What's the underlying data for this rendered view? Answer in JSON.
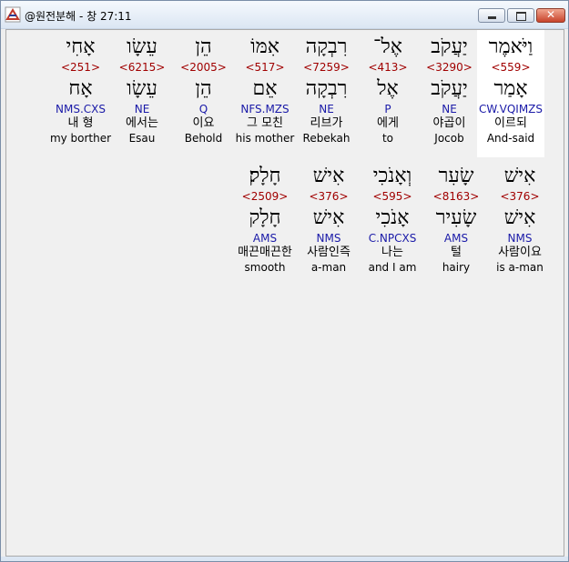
{
  "window": {
    "title": "@원전분해 - 창 27:11",
    "close_glyph": "✕"
  },
  "row1": [
    {
      "heb": "וַיֹּאמֶר",
      "strong": "<559>",
      "lemma": "אָמַר",
      "parse": "CW.VQIMZS",
      "kor": "이르되",
      "eng": "And-said",
      "selected": true
    },
    {
      "heb": "יַעֲקֹב",
      "strong": "<3290>",
      "lemma": "יַעֲקֹב",
      "parse": "NE",
      "kor": "야곱이",
      "eng": "Jocob",
      "selected": false
    },
    {
      "heb": "אֶל־",
      "strong": "<413>",
      "lemma": "אֶל",
      "parse": "P",
      "kor": "에게",
      "eng": "to",
      "selected": false
    },
    {
      "heb": "רִבְקָה",
      "strong": "<7259>",
      "lemma": "רִבְקָה",
      "parse": "NE",
      "kor": "리브가",
      "eng": "Rebekah",
      "selected": false
    },
    {
      "heb": "אִמּוֹ",
      "strong": "<517>",
      "lemma": "אֵם",
      "parse": "NFS.MZS",
      "kor": "그 모친",
      "eng": "his mother",
      "selected": false
    },
    {
      "heb": "הֵן",
      "strong": "<2005>",
      "lemma": "הֵן",
      "parse": "Q",
      "kor": "이요",
      "eng": "Behold",
      "selected": false
    },
    {
      "heb": "עֵשָׂו",
      "strong": "<6215>",
      "lemma": "עֵשָׂו",
      "parse": "NE",
      "kor": "에서는",
      "eng": "Esau",
      "selected": false
    },
    {
      "heb": "אָחִי",
      "strong": "<251>",
      "lemma": "אָח",
      "parse": "NMS.CXS",
      "kor": "내 형",
      "eng": "my borther",
      "selected": false
    }
  ],
  "row2": [
    {
      "heb": "אִישׁ",
      "strong": "<376>",
      "lemma": "אִישׁ",
      "parse": "NMS",
      "kor": "사람이요",
      "eng": "is a-man"
    },
    {
      "heb": "שָׂעִר",
      "strong": "<8163>",
      "lemma": "שָׂעִיר",
      "parse": "AMS",
      "kor": "털",
      "eng": "hairy"
    },
    {
      "heb": "וְאָנֹכִי",
      "strong": "<595>",
      "lemma": "אָנֹכִי",
      "parse": "C.NPCXS",
      "kor": "나는",
      "eng": "and I am"
    },
    {
      "heb": "אִישׁ",
      "strong": "<376>",
      "lemma": "אִישׁ",
      "parse": "NMS",
      "kor": "사람인즉",
      "eng": "a-man"
    },
    {
      "heb": "חָלָק׃",
      "strong": "<2509>",
      "lemma": "חָלָק",
      "parse": "AMS",
      "kor": "매끈매끈한",
      "eng": "smooth"
    }
  ],
  "colors": {
    "strong": "#a00000",
    "parse": "#1a1aa8",
    "selected_bg": "#ffffff"
  }
}
